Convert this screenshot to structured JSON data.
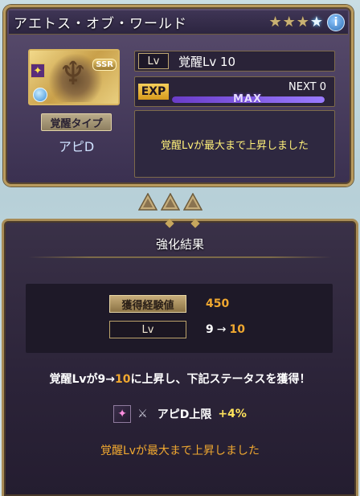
{
  "summon": {
    "name": "アエトス・オブ・ワールド",
    "stars_filled": 3,
    "stars_total": 4,
    "info_label": "i"
  },
  "thumbnail": {
    "rarity": "SSR",
    "element_icon": "sun-icon"
  },
  "awakening": {
    "type_label": "覚醒タイプ",
    "type_value": "アピD",
    "lv_tag": "Lv",
    "lv_value": "覚醒Lv 10",
    "exp_tag": "EXP",
    "next_label": "NEXT 0",
    "exp_progress": 1.0,
    "max_label": "MAX",
    "message": "覚醒Lvが最大まで上昇しました"
  },
  "result": {
    "title": "強化結果",
    "exp_label": "獲得経験値",
    "exp_value": "450",
    "lv_label": "Lv",
    "lv_from": "9",
    "lv_arrow": "→",
    "lv_to": "10",
    "summary_prefix": "覚醒Lvが",
    "summary_from": "9→",
    "summary_to": "10",
    "summary_suffix": "に上昇し、下記ステータスを獲得！",
    "bonus_label": "アピD上限",
    "bonus_value": "+4%",
    "footer": "覚醒Lvが最大まで上昇しました"
  },
  "colors": {
    "accent_gold": "#f0a830",
    "message_yellow": "#fff07a",
    "frame_gold": "#b99b5e"
  }
}
